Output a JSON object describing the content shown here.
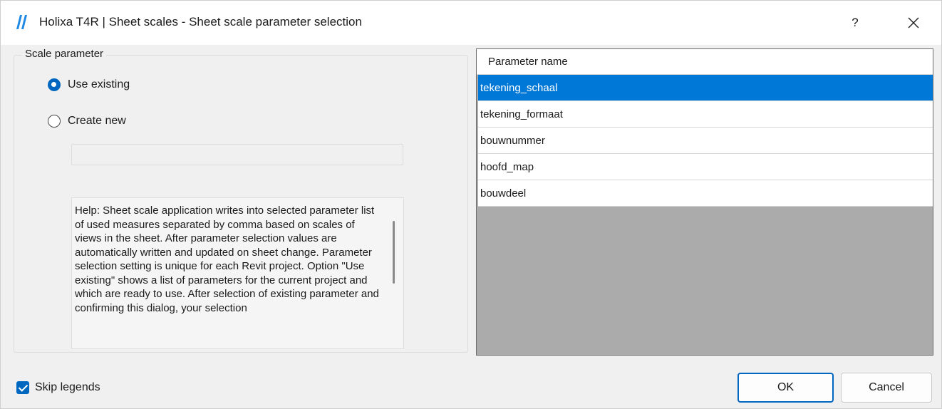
{
  "window": {
    "title": "Holixa T4R | Sheet scales - Sheet scale parameter selection",
    "help_label": "?",
    "brand_color": "#0067c0"
  },
  "scale_parameter": {
    "legend": "Scale parameter",
    "options": [
      {
        "label": "Use existing",
        "checked": true
      },
      {
        "label": "Create new",
        "checked": false
      }
    ],
    "new_name_value": "",
    "help_text": "Help: Sheet scale application writes into selected parameter list of used measures separated by comma based on scales of views in the sheet. After parameter selection values are automatically written and updated on sheet change. Parameter selection setting is unique for each Revit project. Option \"Use existing\" shows a list of parameters for the current project and which are ready to use. After selection of existing parameter and confirming this dialog, your selection"
  },
  "parameters": {
    "header": "Parameter name",
    "rows": [
      {
        "name": "tekening_schaal",
        "selected": true
      },
      {
        "name": "tekening_formaat",
        "selected": false
      },
      {
        "name": "bouwnummer",
        "selected": false
      },
      {
        "name": "hoofd_map",
        "selected": false
      },
      {
        "name": "bouwdeel",
        "selected": false
      }
    ]
  },
  "footer": {
    "skip_legends_label": "Skip legends",
    "skip_legends_checked": true,
    "ok_label": "OK",
    "cancel_label": "Cancel"
  }
}
